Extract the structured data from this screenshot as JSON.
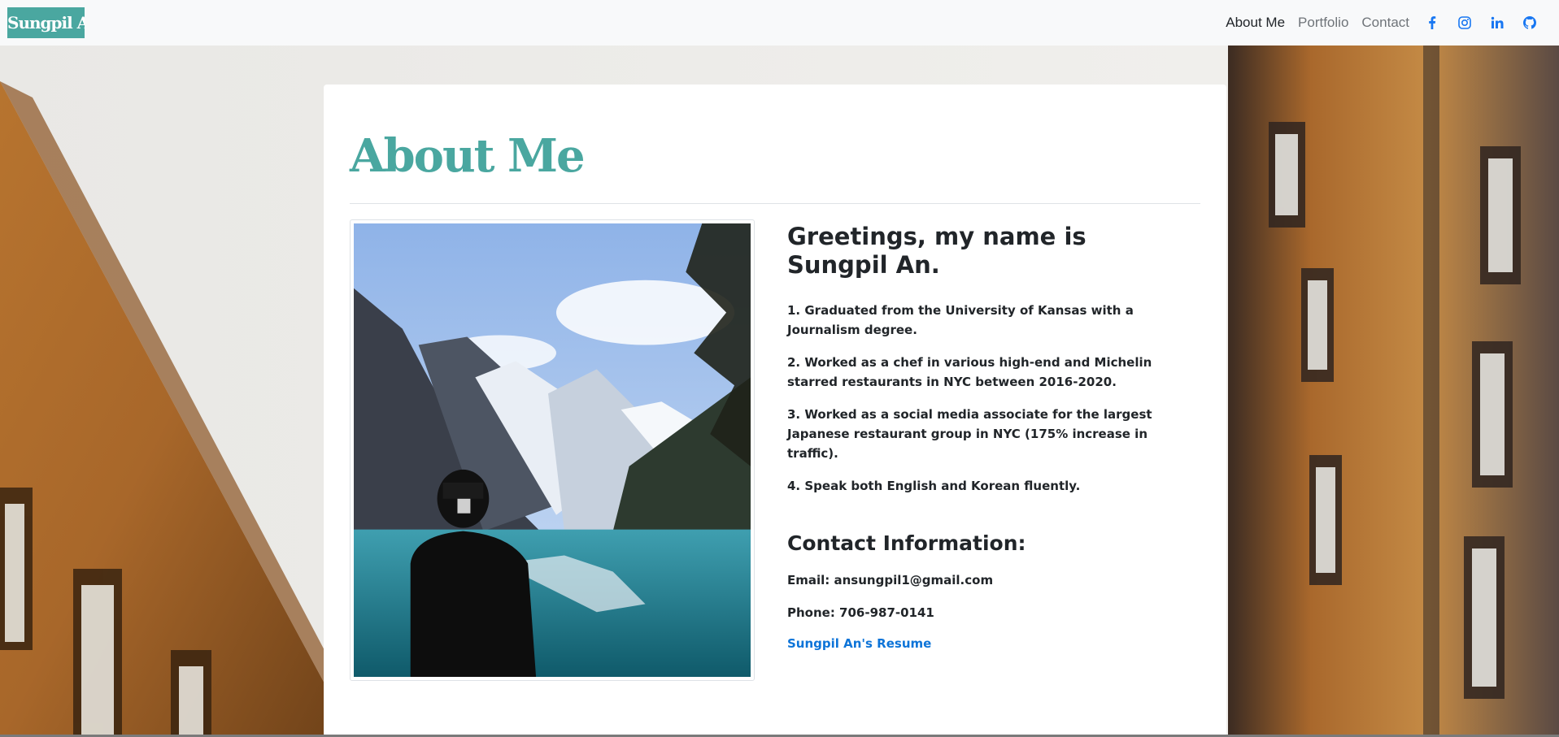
{
  "navbar": {
    "brand": "Sungpil An",
    "links": [
      {
        "label": "About Me",
        "active": true
      },
      {
        "label": "Portfolio",
        "active": false
      },
      {
        "label": "Contact",
        "active": false
      }
    ],
    "social": [
      {
        "icon": "facebook-icon"
      },
      {
        "icon": "instagram-icon"
      },
      {
        "icon": "linkedin-icon"
      },
      {
        "icon": "github-icon"
      }
    ]
  },
  "main": {
    "title": "About Me",
    "greeting": "Greetings, my name is Sungpil An.",
    "facts": [
      "1. Graduated from the University of Kansas with a Journalism degree.",
      "2. Worked as a chef in various high-end and Michelin starred restaurants in NYC between 2016-2020.",
      "3. Worked as a social media associate for the largest Japanese restaurant group in NYC (175% increase in traffic).",
      "4. Speak both English and Korean fluently."
    ],
    "contact_heading": "Contact Information:",
    "email": "Email: ansungpil1@gmail.com",
    "phone": "Phone: 706-987-0141",
    "resume_link": "Sungpil An's Resume"
  },
  "colors": {
    "accent": "#4aa7a0",
    "link": "#0d74d8",
    "text": "#212529",
    "navbar_bg": "#f8f9fa"
  }
}
